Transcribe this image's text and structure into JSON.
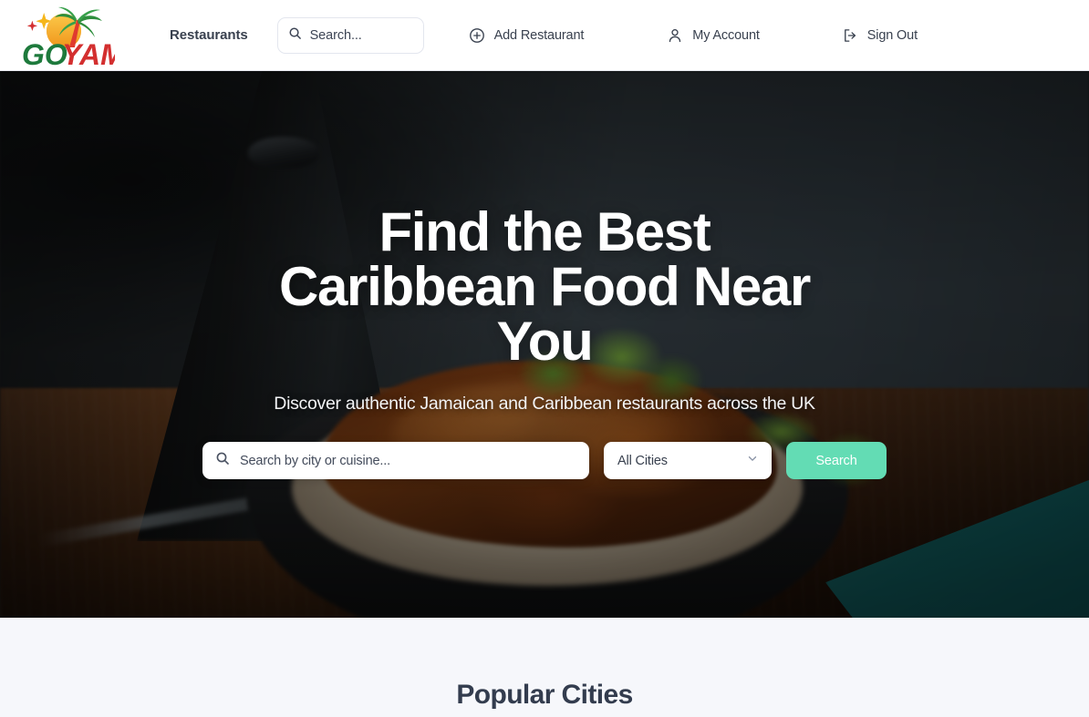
{
  "header": {
    "logo": {
      "name": "GoYam!",
      "text_go": "Go",
      "text_yam": "YAM!",
      "colors": {
        "go": "#1e7a3c",
        "yam": "#d32f2f",
        "sun": "#f5a623",
        "palm": "#2f8f3e",
        "sparkle_yellow": "#f5b61a",
        "sparkle_red": "#d32f2f"
      }
    },
    "nav": {
      "restaurants": "Restaurants"
    },
    "search": {
      "placeholder": "Search...",
      "icon": "search-icon"
    },
    "actions": [
      {
        "label": "Add Restaurant",
        "icon": "plus-circle-icon"
      },
      {
        "label": "My Account",
        "icon": "user-icon"
      },
      {
        "label": "Sign Out",
        "icon": "sign-out-icon"
      }
    ]
  },
  "hero": {
    "title_line1": "Find the Best",
    "title_line2": "Caribbean Food",
    "title_line3": "Near You",
    "title_full": "Find the Best Caribbean Food Near You",
    "subtitle": "Discover authentic Jamaican and Caribbean restaurants across the UK",
    "search": {
      "placeholder": "Search by city or cuisine...",
      "value": "",
      "icon": "search-icon"
    },
    "city_select": {
      "selected": "All Cities",
      "icon": "chevron-down-icon",
      "options": [
        "All Cities"
      ]
    },
    "button": {
      "label": "Search",
      "color": "#63dcb4"
    }
  },
  "section": {
    "title": "Popular Cities",
    "background": "#f6f7fb"
  }
}
